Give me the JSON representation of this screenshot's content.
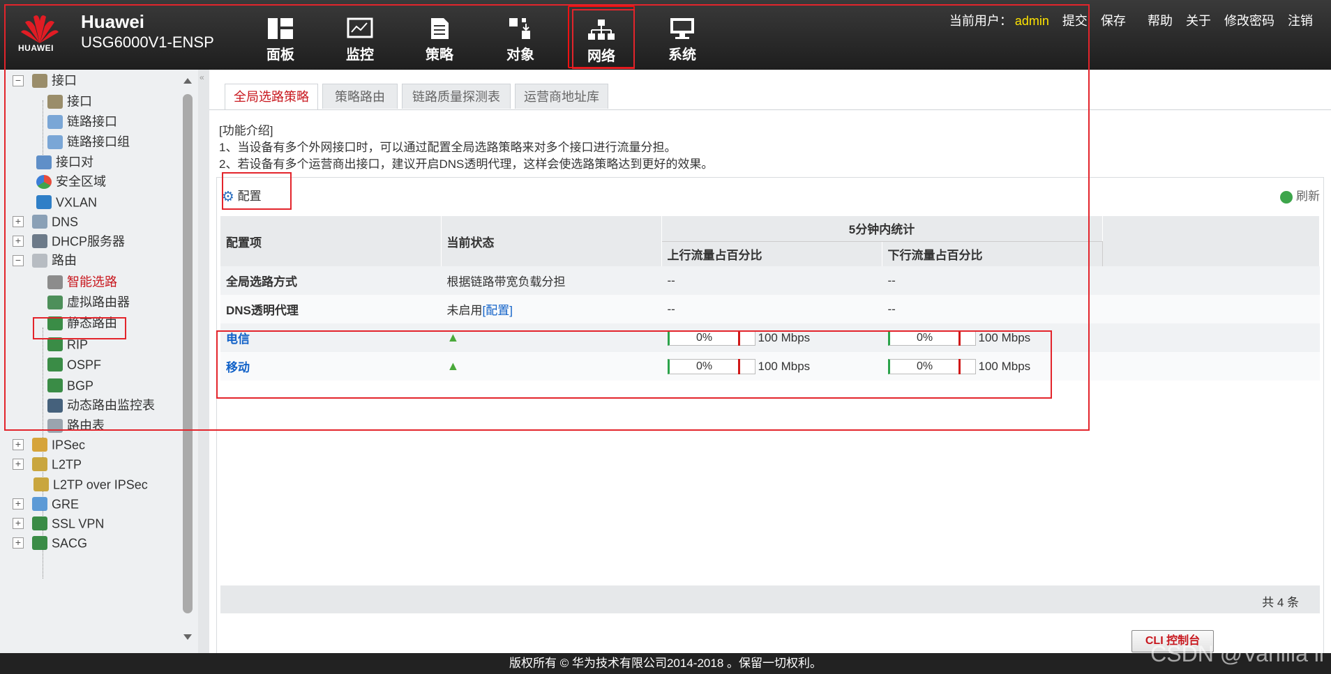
{
  "header": {
    "brand_name": "Huawei",
    "model": "USG6000V1-ENSP",
    "logo_text": "HUAWEI",
    "nav": [
      {
        "label": "面板",
        "icon": "dashboard-icon"
      },
      {
        "label": "监控",
        "icon": "monitor-icon"
      },
      {
        "label": "策略",
        "icon": "policy-icon"
      },
      {
        "label": "对象",
        "icon": "object-icon"
      },
      {
        "label": "网络",
        "icon": "network-icon",
        "active": true
      },
      {
        "label": "系统",
        "icon": "system-icon"
      }
    ],
    "current_user_label": "当前用户：",
    "current_user": "admin",
    "links": [
      "提交",
      "保存",
      "帮助",
      "关于",
      "修改密码",
      "注销"
    ]
  },
  "sidebar": {
    "items": [
      {
        "label": "接口",
        "toggle": "−",
        "level": 0
      },
      {
        "label": "接口",
        "level": 1
      },
      {
        "label": "链路接口",
        "level": 1
      },
      {
        "label": "链路接口组",
        "level": 1
      },
      {
        "label": "接口对",
        "level": 0
      },
      {
        "label": "安全区域",
        "level": 0
      },
      {
        "label": "VXLAN",
        "level": 0
      },
      {
        "label": "DNS",
        "toggle": "+",
        "level": 0
      },
      {
        "label": "DHCP服务器",
        "toggle": "+",
        "level": 0
      },
      {
        "label": "路由",
        "toggle": "−",
        "level": 0
      },
      {
        "label": "智能选路",
        "level": 1,
        "selected": true
      },
      {
        "label": "虚拟路由器",
        "level": 1
      },
      {
        "label": "静态路由",
        "level": 1
      },
      {
        "label": "RIP",
        "level": 1
      },
      {
        "label": "OSPF",
        "level": 1
      },
      {
        "label": "BGP",
        "level": 1
      },
      {
        "label": "动态路由监控表",
        "level": 1
      },
      {
        "label": "路由表",
        "level": 1
      },
      {
        "label": "IPSec",
        "toggle": "+",
        "level": 0
      },
      {
        "label": "L2TP",
        "toggle": "+",
        "level": 0
      },
      {
        "label": "L2TP over IPSec",
        "level": 0
      },
      {
        "label": "GRE",
        "toggle": "+",
        "level": 0
      },
      {
        "label": "SSL VPN",
        "toggle": "+",
        "level": 0
      },
      {
        "label": "SACG",
        "toggle": "+",
        "level": 0
      }
    ]
  },
  "main": {
    "tabs": [
      "全局选路策略",
      "策略路由",
      "链路质量探测表",
      "运营商地址库"
    ],
    "intro": {
      "title": "[功能介绍]",
      "line1": "1、当设备有多个外网接口时，可以通过配置全局选路策略来对多个接口进行流量分担。",
      "line2": "2、若设备有多个运营商出接口，建议开启DNS透明代理，这样会使选路策略达到更好的效果。"
    },
    "config_button": "配置",
    "refresh_button": "刷新",
    "table": {
      "headers": {
        "item": "配置项",
        "status": "当前状态",
        "stats_group": "5分钟内统计",
        "up": "上行流量占百分比",
        "down": "下行流量占百分比"
      },
      "rows": [
        {
          "item": "全局选路方式",
          "status": "根据链路带宽负载分担",
          "up": "--",
          "down": "--"
        },
        {
          "item": "DNS透明代理",
          "status": "未启用",
          "status_link": "[配置]",
          "up": "--",
          "down": "--"
        }
      ],
      "links": [
        {
          "name": "电信",
          "up_pct": "0%",
          "up_bw": "100 Mbps",
          "down_pct": "0%",
          "down_bw": "100 Mbps"
        },
        {
          "name": "移动",
          "up_pct": "0%",
          "up_bw": "100 Mbps",
          "down_pct": "0%",
          "down_bw": "100 Mbps"
        }
      ]
    },
    "total": "共 4 条",
    "cli_button": "CLI 控制台"
  },
  "footer": {
    "copyright": "版权所有 © 华为技术有限公司2014-2018 。保留一切权利。",
    "watermark": "CSDN @Vanilla li"
  }
}
